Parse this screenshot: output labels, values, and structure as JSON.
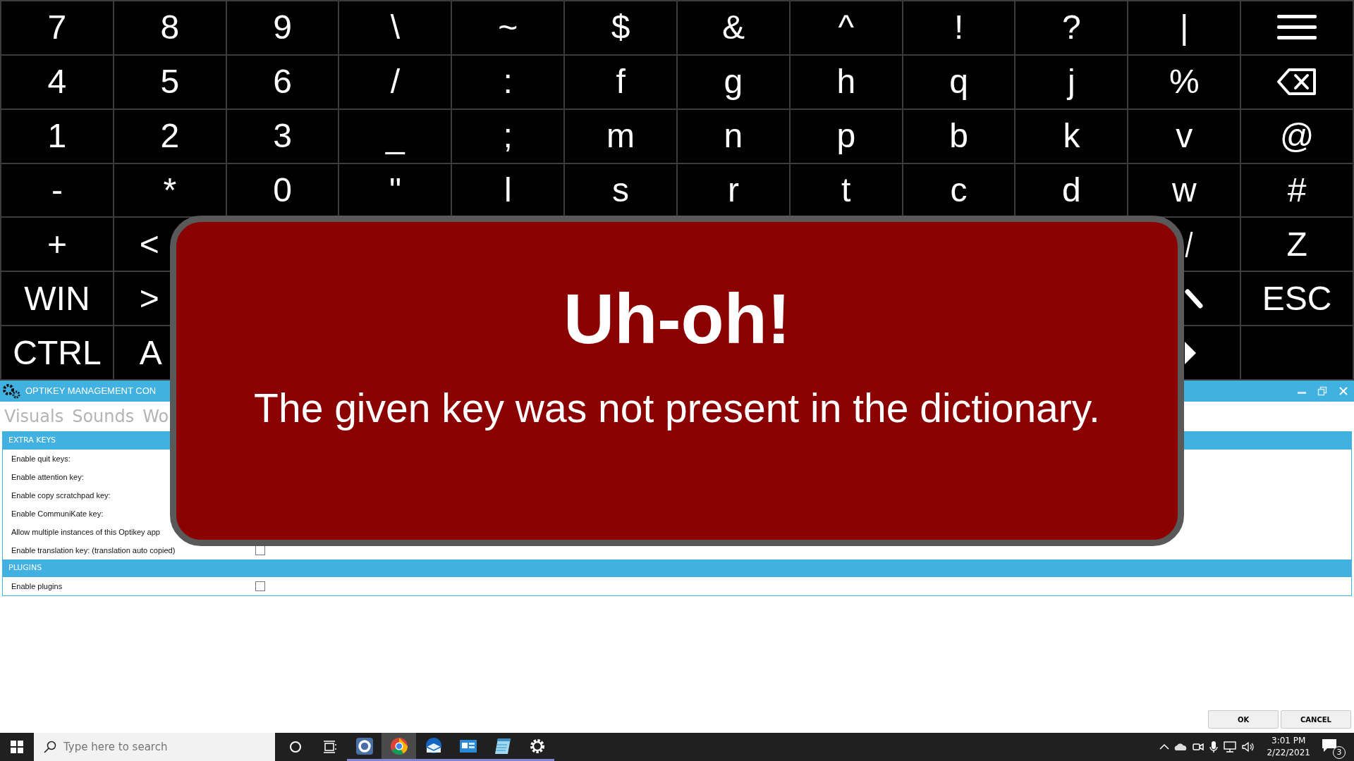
{
  "keyboard": {
    "rows": [
      [
        {
          "kind": "text",
          "label": "7"
        },
        {
          "kind": "text",
          "label": "8"
        },
        {
          "kind": "text",
          "label": "9"
        },
        {
          "kind": "text",
          "label": "\\"
        },
        {
          "kind": "text",
          "label": "~"
        },
        {
          "kind": "text",
          "label": "$"
        },
        {
          "kind": "text",
          "label": "&"
        },
        {
          "kind": "text",
          "label": "^"
        },
        {
          "kind": "text",
          "label": "!"
        },
        {
          "kind": "text",
          "label": "?"
        },
        {
          "kind": "text",
          "label": "|"
        },
        {
          "kind": "menu"
        }
      ],
      [
        {
          "kind": "text",
          "label": "4"
        },
        {
          "kind": "text",
          "label": "5"
        },
        {
          "kind": "text",
          "label": "6"
        },
        {
          "kind": "text",
          "label": "/"
        },
        {
          "kind": "text",
          "label": ":"
        },
        {
          "kind": "text",
          "label": "f"
        },
        {
          "kind": "text",
          "label": "g"
        },
        {
          "kind": "text",
          "label": "h"
        },
        {
          "kind": "text",
          "label": "q"
        },
        {
          "kind": "text",
          "label": "j"
        },
        {
          "kind": "text",
          "label": "%"
        },
        {
          "kind": "backspace"
        }
      ],
      [
        {
          "kind": "text",
          "label": "1"
        },
        {
          "kind": "text",
          "label": "2"
        },
        {
          "kind": "text",
          "label": "3"
        },
        {
          "kind": "text",
          "label": "_"
        },
        {
          "kind": "text",
          "label": ";"
        },
        {
          "kind": "text",
          "label": "m"
        },
        {
          "kind": "text",
          "label": "n"
        },
        {
          "kind": "text",
          "label": "p"
        },
        {
          "kind": "text",
          "label": "b"
        },
        {
          "kind": "text",
          "label": "k"
        },
        {
          "kind": "text",
          "label": "v"
        },
        {
          "kind": "text",
          "label": "@"
        }
      ],
      [
        {
          "kind": "text",
          "label": "-"
        },
        {
          "kind": "text",
          "label": "*"
        },
        {
          "kind": "text",
          "label": "0"
        },
        {
          "kind": "text",
          "label": "\""
        },
        {
          "kind": "text",
          "label": "l"
        },
        {
          "kind": "text",
          "label": "s"
        },
        {
          "kind": "text",
          "label": "r"
        },
        {
          "kind": "text",
          "label": "t"
        },
        {
          "kind": "text",
          "label": "c"
        },
        {
          "kind": "text",
          "label": "d"
        },
        {
          "kind": "text",
          "label": "w"
        },
        {
          "kind": "text",
          "label": "#"
        }
      ],
      [
        {
          "kind": "text",
          "label": "+"
        },
        {
          "kind": "covered",
          "label": "<"
        },
        {
          "kind": "hidden"
        },
        {
          "kind": "hidden"
        },
        {
          "kind": "hidden"
        },
        {
          "kind": "hidden"
        },
        {
          "kind": "hidden"
        },
        {
          "kind": "hidden"
        },
        {
          "kind": "hidden"
        },
        {
          "kind": "hidden"
        },
        {
          "kind": "slash-fragment"
        },
        {
          "kind": "text",
          "label": "Z"
        }
      ],
      [
        {
          "kind": "text",
          "label": "WIN"
        },
        {
          "kind": "covered",
          "label": ">"
        },
        {
          "kind": "hidden"
        },
        {
          "kind": "hidden"
        },
        {
          "kind": "hidden"
        },
        {
          "kind": "hidden"
        },
        {
          "kind": "hidden"
        },
        {
          "kind": "hidden"
        },
        {
          "kind": "hidden"
        },
        {
          "kind": "hidden"
        },
        {
          "kind": "line-fragment"
        },
        {
          "kind": "text",
          "label": "ESC"
        }
      ],
      [
        {
          "kind": "text",
          "label": "CTRL"
        },
        {
          "kind": "covered",
          "label": "A"
        },
        {
          "kind": "hidden"
        },
        {
          "kind": "hidden"
        },
        {
          "kind": "hidden"
        },
        {
          "kind": "hidden"
        },
        {
          "kind": "hidden"
        },
        {
          "kind": "hidden"
        },
        {
          "kind": "hidden"
        },
        {
          "kind": "hidden"
        },
        {
          "kind": "arrow-fragment"
        },
        {
          "kind": "blank"
        }
      ]
    ]
  },
  "console": {
    "title": "OPTIKEY MANAGEMENT CON",
    "tabs": [
      {
        "label": "Visuals"
      },
      {
        "label": "Sounds"
      },
      {
        "label": "Wo"
      }
    ],
    "sections": [
      {
        "title": "EXTRA KEYS",
        "settings": [
          {
            "label": "Enable quit keys:"
          },
          {
            "label": "Enable attention key:"
          },
          {
            "label": "Enable copy scratchpad key:"
          },
          {
            "label": "Enable CommuniKate key:"
          },
          {
            "label": "Allow multiple instances of this Optikey app"
          },
          {
            "label": "Enable translation key: (translation auto copied)",
            "checked": false
          }
        ]
      },
      {
        "title": "PLUGINS",
        "settings": [
          {
            "label": "Enable plugins",
            "checked": false
          }
        ]
      }
    ],
    "buttons": [
      "OK",
      "CANCEL"
    ]
  },
  "dialog": {
    "title": "Uh-oh!",
    "message": "The given key was not present in the dictionary."
  },
  "taskbar": {
    "search": {
      "placeholder": "Type here to search"
    },
    "apps": [
      {
        "kind": "ring",
        "selected": false
      },
      {
        "kind": "chrome",
        "selected": true
      },
      {
        "kind": "mail",
        "selected": false
      },
      {
        "kind": "panel",
        "selected": false
      },
      {
        "kind": "notepad",
        "selected": false
      },
      {
        "kind": "gear",
        "selected": false
      }
    ],
    "time": "3:01 PM",
    "date": "2/22/2021",
    "notifications": "3"
  }
}
